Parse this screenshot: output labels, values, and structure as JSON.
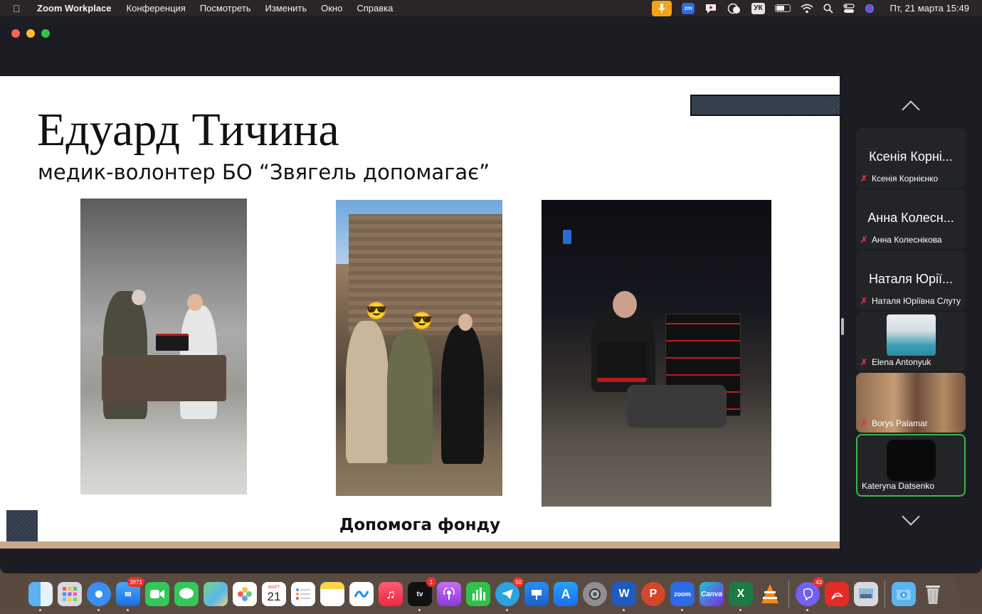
{
  "menubar": {
    "app_name": "Zoom Workplace",
    "menus": [
      "Конференция",
      "Посмотреть",
      "Изменить",
      "Окно",
      "Справка"
    ],
    "keyboard_layout": "УК",
    "clock": "Пт, 21 марта  15:49"
  },
  "slide": {
    "title": "Едуард Тичина",
    "subtitle": "медик-волонтер БО “Звягель допомагає”",
    "caption": "Допомога фонду"
  },
  "participants": [
    {
      "big_name": "Ксенія Корні...",
      "name": "Ксенія Корнієнко",
      "muted": true
    },
    {
      "big_name": "Анна Колесн...",
      "name": "Анна Колеснікова",
      "muted": true
    },
    {
      "big_name": "Наталя Юрії...",
      "name": "Наталя Юріївна Слуту",
      "muted": true
    },
    {
      "name": "Elena Antonyuk",
      "muted": true
    },
    {
      "name": "Borys Palamar",
      "muted": true
    },
    {
      "name": "Kateryna Datsenko",
      "muted": false
    }
  ],
  "dock": {
    "badges": {
      "mail": "3871",
      "appletv": "1",
      "telegram": "50",
      "viber": "43"
    },
    "calendar_month": "МАРТ",
    "calendar_day": "21"
  },
  "colors": {
    "menubar": "#2b2527",
    "zoom_bg": "#1b1d22",
    "active_speaker": "#3ab749",
    "mute_red": "#e0323a"
  }
}
